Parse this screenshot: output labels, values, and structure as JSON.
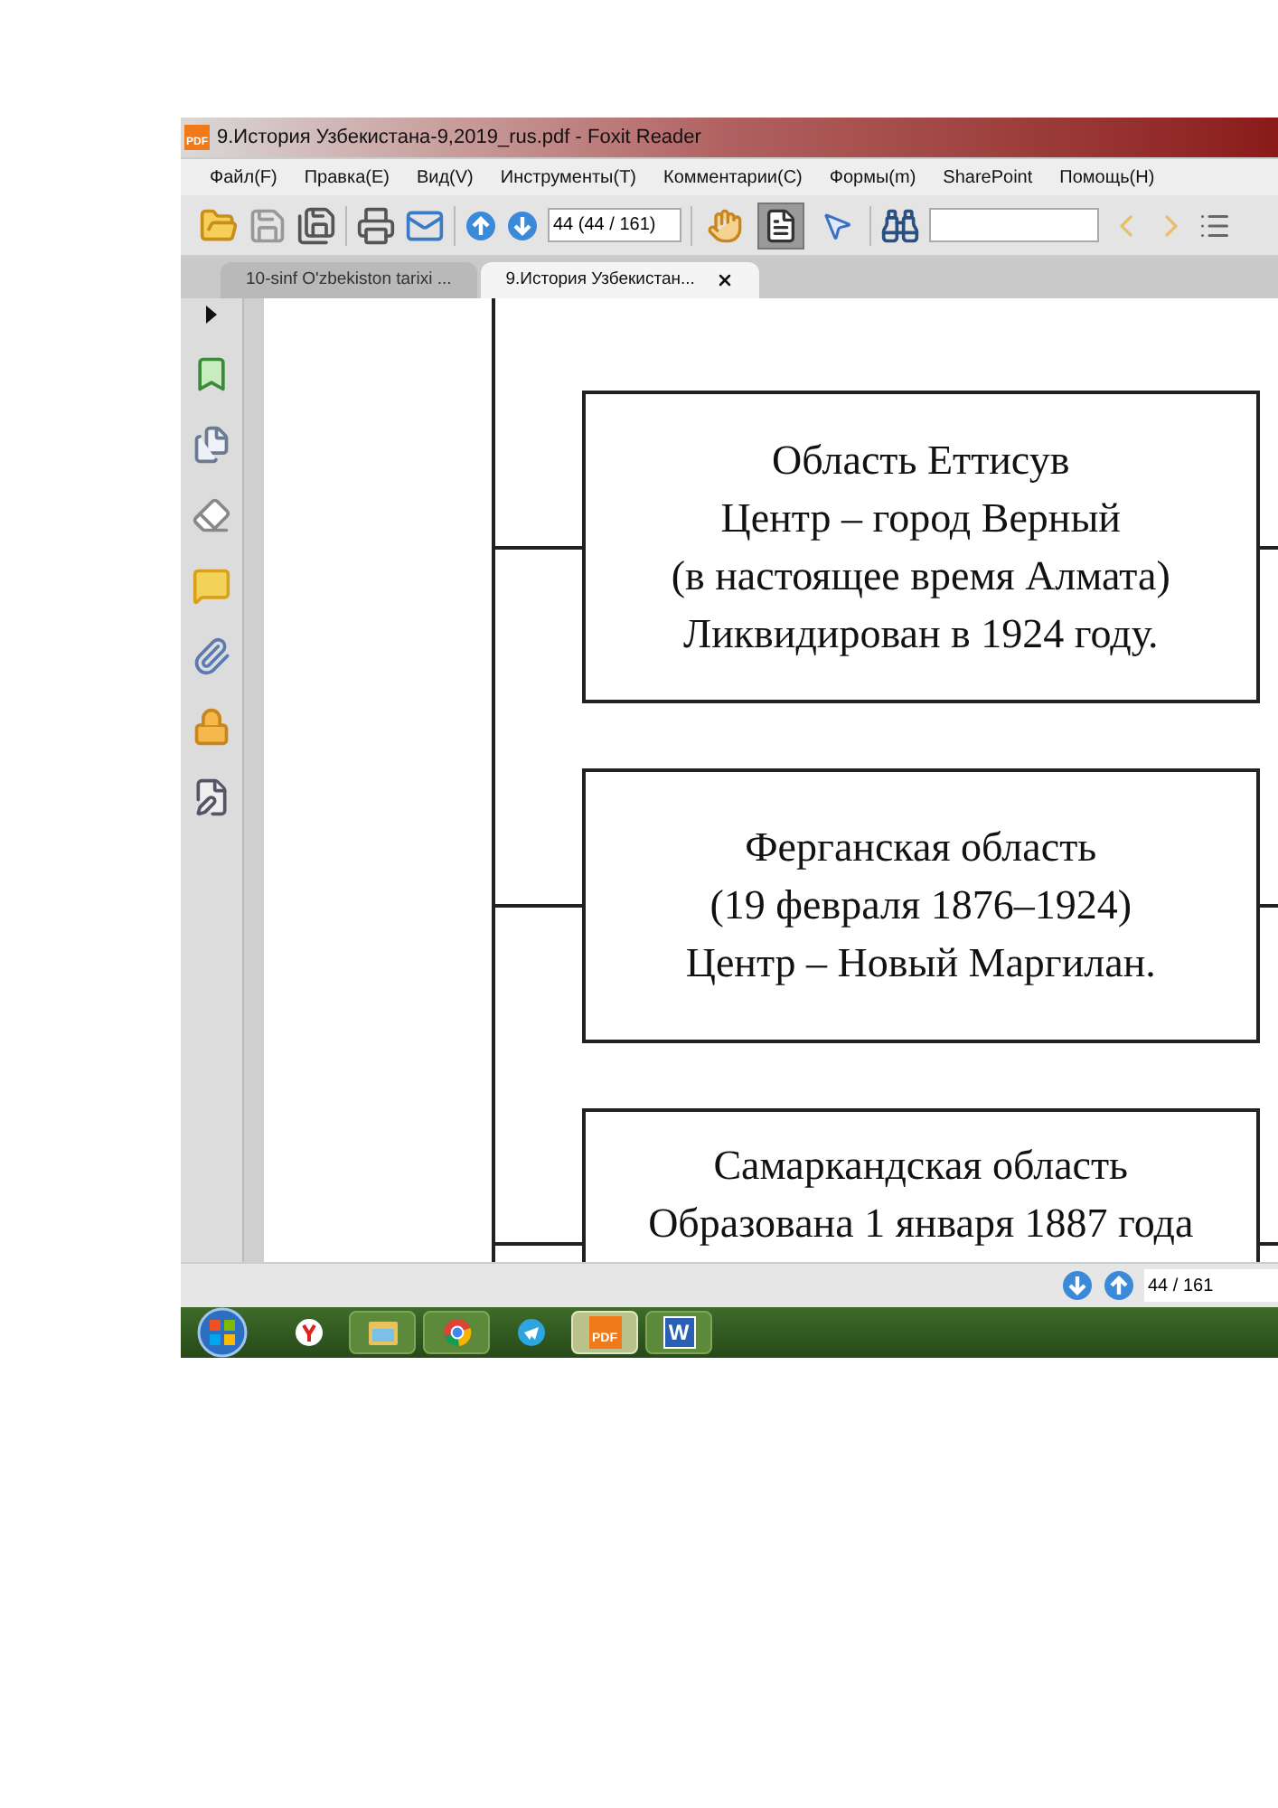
{
  "window": {
    "title": "9.История Узбекистана-9,2019_rus.pdf - Foxit Reader",
    "app_icon_label": "PDF"
  },
  "menu": [
    "Файл(F)",
    "Правка(E)",
    "Вид(V)",
    "Инструменты(T)",
    "Комментарии(C)",
    "Формы(m)",
    "SharePoint",
    "Помощь(H)"
  ],
  "toolbar": {
    "page_field": "44 (44 / 161)",
    "tools": [
      {
        "kind": "hand",
        "selected": false
      },
      {
        "kind": "text-select",
        "selected": true
      },
      {
        "kind": "pointer",
        "selected": false
      }
    ]
  },
  "tabs": [
    {
      "label": "10-sinf O'zbekiston tarixi ...",
      "selected": false
    },
    {
      "label": "9.История Узбекистан...",
      "selected": true
    }
  ],
  "document": {
    "boxes": [
      {
        "lines": [
          "Область Еттисув",
          "Центр – город Верный",
          "(в настоящее время Алмата)",
          "Ликвидирован в 1924 году."
        ]
      },
      {
        "lines": [
          "Ферганская область",
          "(19 февраля 1876–1924)",
          "Центр – Новый Маргилан."
        ]
      },
      {
        "lines": [
          "Самаркандская область",
          "Образована 1 января 1887 года"
        ]
      }
    ]
  },
  "status_bar": {
    "page_field": "44 / 161"
  },
  "taskbar": {
    "items": [
      {
        "kind": "yandex",
        "selected": false
      },
      {
        "kind": "folder",
        "selected": false
      },
      {
        "kind": "chrome",
        "selected": false
      },
      {
        "kind": "telegram",
        "selected": false
      },
      {
        "kind": "pdf",
        "selected": true,
        "label": "PDF"
      },
      {
        "kind": "word",
        "selected": false,
        "label": "W"
      }
    ]
  }
}
